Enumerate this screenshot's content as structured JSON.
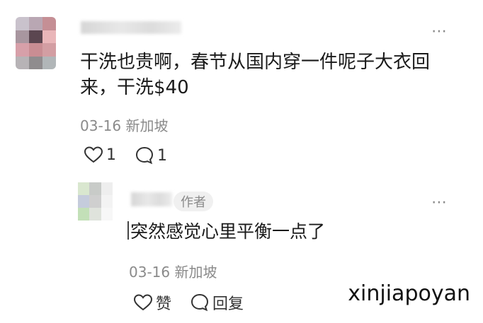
{
  "comment": {
    "content_line1": "干洗也贵啊，春节从国内穿一件呢子大衣回",
    "content_line2": "来，干洗$40",
    "meta": "03-16 新加坡",
    "like_count": "1",
    "reply_count": "1",
    "more_icon": "⋯"
  },
  "reply": {
    "author_tag": "作者",
    "content": "突然感觉心里平衡一点了",
    "meta": "03-16 新加坡",
    "like_label": "赞",
    "reply_label": "回复",
    "more_icon": "⋯"
  },
  "watermark": "xinjiapoyan",
  "colors": {
    "text": "#1a1a1a",
    "meta": "#8a8a8a",
    "tag_bg": "#f0f0f0"
  },
  "icons": [
    "heart-icon",
    "comment-bubble-icon",
    "more-dots-icon"
  ]
}
